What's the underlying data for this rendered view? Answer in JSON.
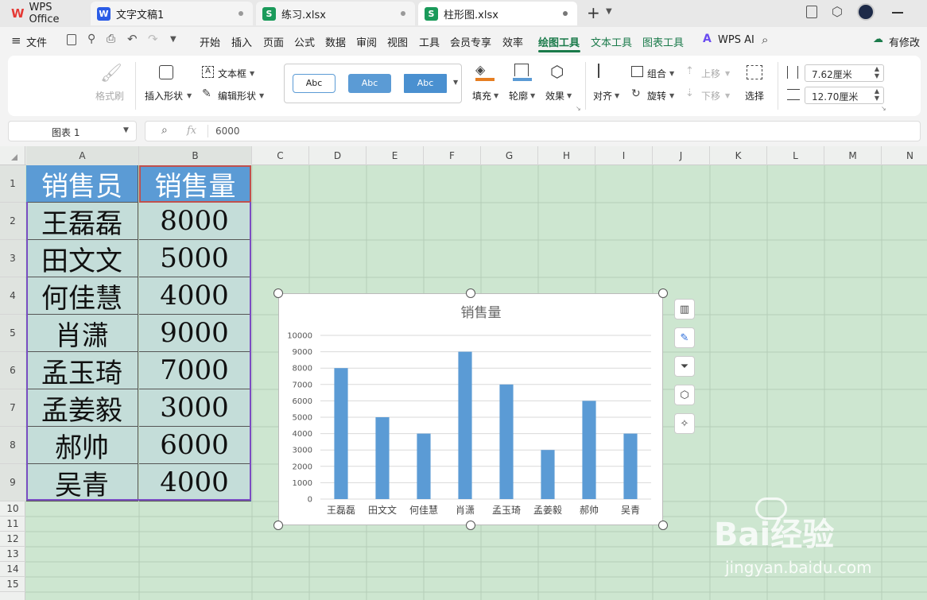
{
  "tabs": [
    {
      "label": "WPS Office",
      "icon": "wps-logo-icon"
    },
    {
      "label": "文字文稿1",
      "icon": "W"
    },
    {
      "label": "练习.xlsx",
      "icon": "S"
    },
    {
      "label": "柱形图.xlsx",
      "icon": "S",
      "active": true
    }
  ],
  "menu": {
    "file": "文件",
    "items": [
      "开始",
      "插入",
      "页面",
      "公式",
      "数据",
      "审阅",
      "视图",
      "工具",
      "会员专享",
      "效率"
    ],
    "drawing_tools": "绘图工具",
    "text_tools": "文本工具",
    "chart_tools": "图表工具",
    "wps_ai": "WPS AI",
    "modify": "有修改"
  },
  "ribbon": {
    "format_painter": "格式刷",
    "insert_shape": "插入形状",
    "text_box": "文本框",
    "edit_shape": "编辑形状",
    "style_samples": [
      "Abc",
      "Abc",
      "Abc"
    ],
    "fill": "填充",
    "outline": "轮廓",
    "effects": "效果",
    "align": "对齐",
    "group": "组合",
    "rotate": "旋转",
    "move_up": "上移",
    "move_down": "下移",
    "select": "选择",
    "height": "7.62厘米",
    "width": "12.70厘米"
  },
  "formula_bar": {
    "name_box": "图表 1",
    "fx": "fx",
    "value": "6000"
  },
  "columns": [
    "A",
    "B",
    "C",
    "D",
    "E",
    "F",
    "G",
    "H",
    "I",
    "J",
    "K",
    "L",
    "M",
    "N"
  ],
  "rows": [
    "1",
    "2",
    "3",
    "4",
    "5",
    "6",
    "7",
    "8",
    "9",
    "10",
    "11",
    "12",
    "13",
    "14",
    "15"
  ],
  "table": {
    "headers": [
      "销售员",
      "销售量"
    ],
    "rows": [
      [
        "王磊磊",
        "8000"
      ],
      [
        "田文文",
        "5000"
      ],
      [
        "何佳慧",
        "4000"
      ],
      [
        "肖潇",
        "9000"
      ],
      [
        "孟玉琦",
        "7000"
      ],
      [
        "孟姜毅",
        "3000"
      ],
      [
        "郝帅",
        "6000"
      ],
      [
        "吴青",
        "4000"
      ]
    ]
  },
  "chart_data": {
    "type": "bar",
    "title": "销售量",
    "categories": [
      "王磊磊",
      "田文文",
      "何佳慧",
      "肖潇",
      "孟玉琦",
      "孟姜毅",
      "郝帅",
      "吴青"
    ],
    "values": [
      8000,
      5000,
      4000,
      9000,
      7000,
      3000,
      6000,
      4000
    ],
    "yticks": [
      "0",
      "1000",
      "2000",
      "3000",
      "4000",
      "5000",
      "6000",
      "7000",
      "8000",
      "9000",
      "10000"
    ],
    "ylim": [
      0,
      10000
    ],
    "grid": true,
    "bar_color": "#5b9bd5"
  },
  "watermark": {
    "text": "Bai经验",
    "url": "jingyan.baidu.com"
  },
  "colors": {
    "accent": "#1a7a4a",
    "sheet_bg": "#cde6d0"
  }
}
